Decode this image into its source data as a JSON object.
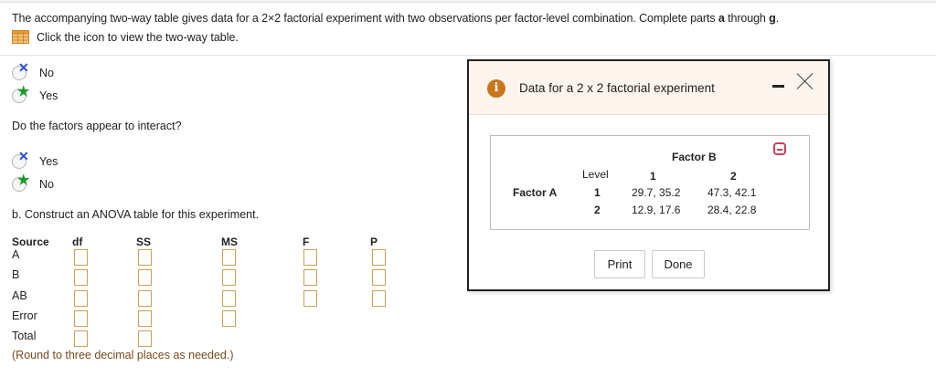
{
  "question": {
    "text_before": "The accompanying two-way table gives data for a 2×2 factorial experiment with two observations per factor-level combination. Complete parts ",
    "part_a": "a",
    "text_mid": " through ",
    "part_g": "g",
    "text_end": "."
  },
  "table_link": {
    "label": "Click the icon to view the two-way table.",
    "icon": "table-grid-icon"
  },
  "question1": {
    "options": [
      {
        "label": "No",
        "mark": "incorrect"
      },
      {
        "label": "Yes",
        "mark": "correct"
      }
    ]
  },
  "question2": {
    "prompt": "Do the factors appear to interact?",
    "options": [
      {
        "label": "Yes",
        "mark": "incorrect"
      },
      {
        "label": "No",
        "mark": "correct"
      }
    ]
  },
  "part_b": {
    "prompt": "b. Construct an ANOVA table for this experiment."
  },
  "anova": {
    "headers": [
      "Source",
      "df",
      "SS",
      "MS",
      "F",
      "P"
    ],
    "rows": [
      "A",
      "B",
      "AB",
      "Error",
      "Total"
    ],
    "note": "(Round to three decimal places as needed.)"
  },
  "dialog": {
    "title": "Data for a 2 x 2 factorial experiment",
    "table": {
      "factor_b_label": "Factor B",
      "level_label": "Level",
      "factor_a_label": "Factor A",
      "b_levels": [
        "1",
        "2"
      ],
      "a_levels": [
        "1",
        "2"
      ],
      "cells": [
        [
          "29.7, 35.2",
          "47.3, 42.1"
        ],
        [
          "12.9, 17.6",
          "28.4, 22.8"
        ]
      ]
    },
    "buttons": {
      "print": "Print",
      "done": "Done"
    }
  },
  "colors": {
    "info_icon": "#c9761b",
    "correct_mark": "#1a9a2a",
    "incorrect_mark": "#2b4bd8",
    "input_border": "#c6a25a",
    "note_text": "#7a4a1c",
    "dialog_header": "#fdf4ee",
    "copy_icon": "#c64060"
  }
}
